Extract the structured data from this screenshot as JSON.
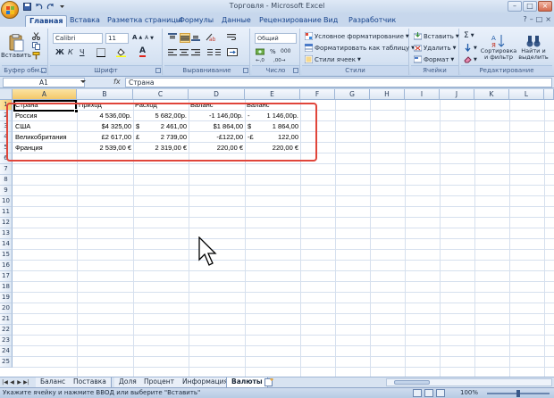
{
  "window": {
    "title": "Торговля - Microsoft Excel",
    "controls": [
      "–",
      "□",
      "×"
    ]
  },
  "tabs": [
    "Главная",
    "Вставка",
    "Разметка страницы",
    "Формулы",
    "Данные",
    "Рецензирование",
    "Вид",
    "Разработчик"
  ],
  "ribbon": {
    "clipboard": {
      "paste_label": "Вставить",
      "group_label": "Буфер обм..."
    },
    "font": {
      "font_name": "Calibri",
      "font_size": "11",
      "bold": "Ж",
      "italic": "К",
      "underline": "Ч",
      "font_color_glyph": "A",
      "grow": "A",
      "shrink": "A",
      "group_label": "Шрифт"
    },
    "alignment": {
      "group_label": "Выравнивание"
    },
    "number": {
      "format": "Общий",
      "percent": "%",
      "thousands": "000",
      "group_label": "Число"
    },
    "styles": {
      "conditional": "Условное форматирование",
      "as_table": "Форматировать как таблицу",
      "cell_styles": "Стили ячеек",
      "group_label": "Стили"
    },
    "cells": {
      "insert": "Вставить",
      "delete": "Удалить",
      "format": "Формат",
      "group_label": "Ячейки"
    },
    "editing": {
      "sigma": "Σ",
      "sort_label": "Сортировка и фильтр",
      "find_label": "Найти и выделить",
      "group_label": "Редактирование"
    }
  },
  "formula_bar": {
    "name_box": "A1",
    "fx": "fx",
    "content": "Страна"
  },
  "columns": [
    "A",
    "B",
    "C",
    "D",
    "E",
    "F",
    "G",
    "H",
    "I",
    "J",
    "K",
    "L"
  ],
  "rows": [
    "1",
    "2",
    "3",
    "4",
    "5",
    "6",
    "7",
    "8",
    "9",
    "10",
    "11",
    "12",
    "13",
    "14",
    "15",
    "16",
    "17",
    "18",
    "19",
    "20",
    "21",
    "22",
    "23",
    "24",
    "25"
  ],
  "cells": {
    "r1": [
      "Страна",
      "Приход",
      "Расход",
      "Баланс",
      "Баланс"
    ],
    "r2": {
      "a": "Россия",
      "b": "4 536,00р.",
      "c": "5 682,00р.",
      "d": "-1 146,00р.",
      "e_sym": "-",
      "e": "1 146,00р."
    },
    "r3": {
      "a": "США",
      "b": "$4 325,00",
      "c_sym": "$",
      "c": "2 461,00",
      "d": "$1 864,00",
      "e_sym": "$",
      "e": "1 864,00"
    },
    "r4": {
      "a": "Великобритания",
      "b": "£2 617,00",
      "c_sym": "£",
      "c": "2 739,00",
      "d": "-£122,00",
      "e_sym": "-£",
      "e": "122,00"
    },
    "r5": {
      "a": "Франция",
      "b": "2 539,00 €",
      "c": "2 319,00 €",
      "d": "220,00 €",
      "e": "220,00 €"
    }
  },
  "sheet_tabs": [
    "Баланс",
    "Поставка",
    "Доля",
    "Процент",
    "Информация",
    "Валюты"
  ],
  "active_sheet": "Валюты",
  "status": {
    "message": "Укажите ячейку и нажмите ВВОД или выберите \"Вставить\"",
    "zoom": "100%"
  },
  "colors": {
    "highlight_frame": "#e0453a",
    "ribbon_blue": "#15428b",
    "header_selected": "#f3c86a"
  }
}
